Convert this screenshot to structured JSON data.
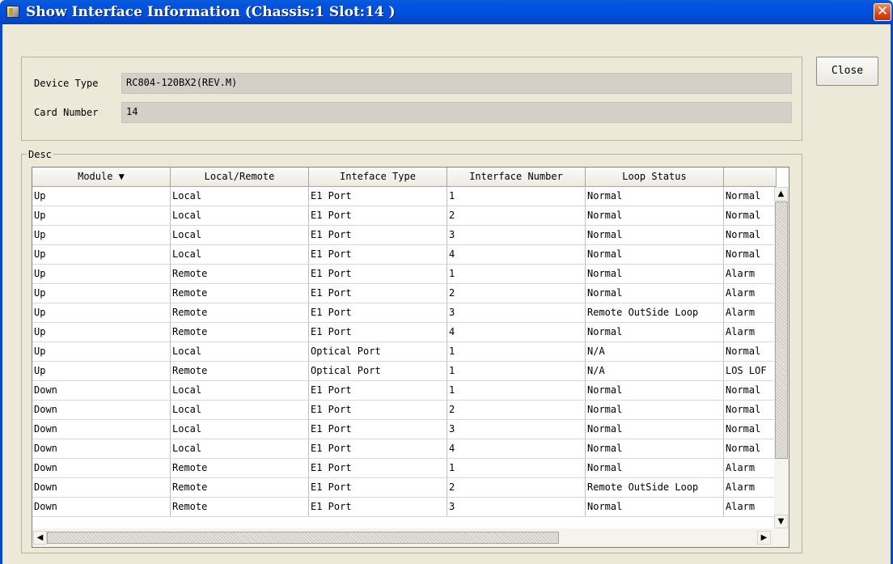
{
  "window": {
    "title": "Show Interface Information (Chassis:1 Slot:14 )",
    "close_glyph": "✕"
  },
  "info": {
    "device_type_label": "Device Type",
    "device_type_value": "RC804-120BX2(REV.M)",
    "card_number_label": "Card Number",
    "card_number_value": "14"
  },
  "buttons": {
    "close_label": "Close"
  },
  "desc": {
    "label": "Desc",
    "columns": [
      "Module ▼",
      "Local/Remote",
      "Inteface Type",
      "Interface Number",
      "Loop Status",
      ""
    ],
    "rows": [
      [
        "Up",
        "Local",
        "E1 Port",
        "1",
        "Normal",
        "Normal"
      ],
      [
        "Up",
        "Local",
        "E1 Port",
        "2",
        "Normal",
        "Normal"
      ],
      [
        "Up",
        "Local",
        "E1 Port",
        "3",
        "Normal",
        "Normal"
      ],
      [
        "Up",
        "Local",
        "E1 Port",
        "4",
        "Normal",
        "Normal"
      ],
      [
        "Up",
        "Remote",
        "E1 Port",
        "1",
        "Normal",
        "Alarm"
      ],
      [
        "Up",
        "Remote",
        "E1 Port",
        "2",
        "Normal",
        "Alarm"
      ],
      [
        "Up",
        "Remote",
        "E1 Port",
        "3",
        "Remote OutSide Loop",
        "Alarm"
      ],
      [
        "Up",
        "Remote",
        "E1 Port",
        "4",
        "Normal",
        "Alarm"
      ],
      [
        "Up",
        "Local",
        "Optical Port",
        "1",
        "N/A",
        "Normal"
      ],
      [
        "Up",
        "Remote",
        "Optical Port",
        "1",
        "N/A",
        "LOS LOF"
      ],
      [
        "Down",
        "Local",
        "E1 Port",
        "1",
        "Normal",
        "Normal"
      ],
      [
        "Down",
        "Local",
        "E1 Port",
        "2",
        "Normal",
        "Normal"
      ],
      [
        "Down",
        "Local",
        "E1 Port",
        "3",
        "Normal",
        "Normal"
      ],
      [
        "Down",
        "Local",
        "E1 Port",
        "4",
        "Normal",
        "Normal"
      ],
      [
        "Down",
        "Remote",
        "E1 Port",
        "1",
        "Normal",
        "Alarm"
      ],
      [
        "Down",
        "Remote",
        "E1 Port",
        "2",
        "Remote OutSide Loop",
        "Alarm"
      ],
      [
        "Down",
        "Remote",
        "E1 Port",
        "3",
        "Normal",
        "Alarm"
      ]
    ]
  },
  "icons": {
    "scroll_up": "▲",
    "scroll_down": "▼",
    "scroll_left": "◀",
    "scroll_right": "▶"
  },
  "colors": {
    "titlebar": "#0150dd",
    "window_bg": "#ece9d8",
    "close_button": "#d34c1c"
  }
}
